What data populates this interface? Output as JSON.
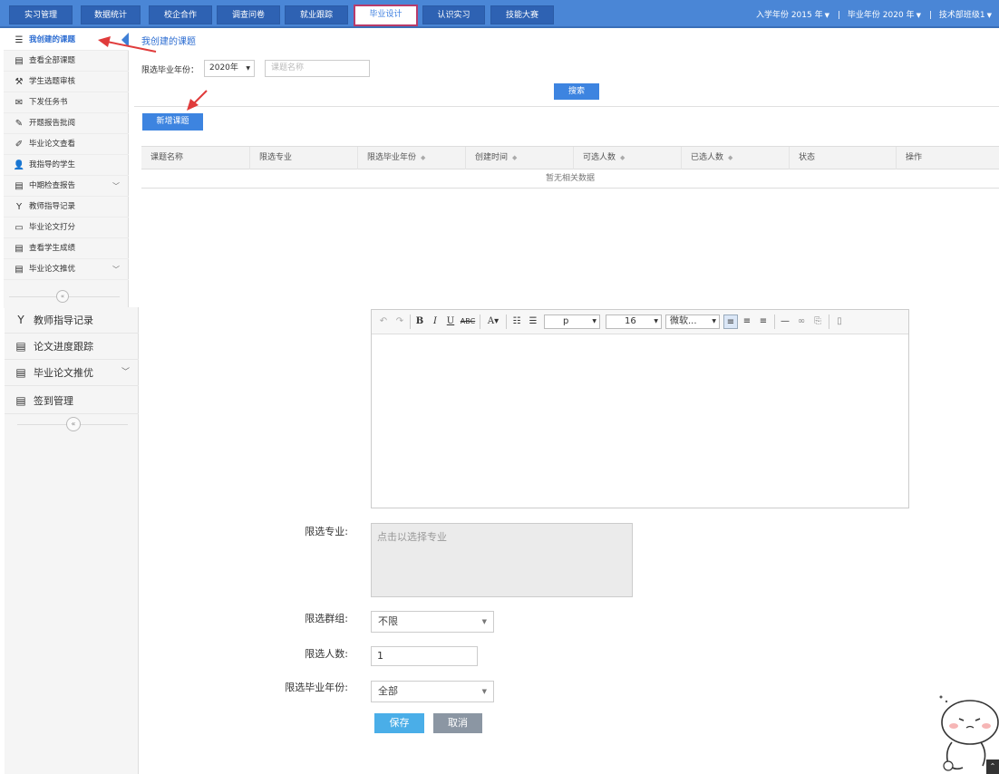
{
  "nav": {
    "tabs": [
      "实习管理",
      "数据统计",
      "校企合作",
      "调查问卷",
      "就业跟踪",
      "毕业设计",
      "认识实习",
      "技能大赛"
    ],
    "active_tab": "毕业设计",
    "enroll_label": "入学年份",
    "enroll_year": "2015 年",
    "grad_label": "毕业年份",
    "grad_year": "2020 年",
    "org": "技术部班级1"
  },
  "sidebar_top": {
    "items": [
      {
        "label": "我创建的课题",
        "icon": "list-icon"
      },
      {
        "label": "查看全部课题",
        "icon": "table-icon"
      },
      {
        "label": "学生选题审核",
        "icon": "gavel-icon"
      },
      {
        "label": "下发任务书",
        "icon": "envelope-icon"
      },
      {
        "label": "开题报告批阅",
        "icon": "pencil-icon"
      },
      {
        "label": "毕业论文查看",
        "icon": "edit-icon"
      },
      {
        "label": "我指导的学生",
        "icon": "user-icon"
      },
      {
        "label": "中期检查报告",
        "icon": "table-icon"
      },
      {
        "label": "教师指导记录",
        "icon": "cup-icon"
      },
      {
        "label": "毕业论文打分",
        "icon": "laptop-icon"
      },
      {
        "label": "查看学生成绩",
        "icon": "table-icon"
      },
      {
        "label": "毕业论文推优",
        "icon": "table-icon"
      }
    ]
  },
  "main": {
    "breadcrumb": "我创建的课题",
    "filter_label": "限选毕业年份：",
    "filter_year": "2020年",
    "search_placeholder": "课题名称",
    "search_button": "搜索",
    "new_button": "新增课题",
    "table": {
      "columns": [
        "课题名称",
        "限选专业",
        "限选毕业年份",
        "创建时间",
        "可选人数",
        "已选人数",
        "状态",
        "操作"
      ],
      "sortable": [
        false,
        false,
        true,
        true,
        true,
        true,
        false,
        false
      ],
      "empty_text": "暂无相关数据"
    }
  },
  "sidebar_bottom": {
    "items": [
      {
        "label": "教师指导记录",
        "icon": "cup-icon"
      },
      {
        "label": "论文进度跟踪",
        "icon": "table-icon"
      },
      {
        "label": "毕业论文推优",
        "icon": "table-icon"
      },
      {
        "label": "签到管理",
        "icon": "table-icon"
      }
    ]
  },
  "editor": {
    "paragraph": "p",
    "font_size": "16",
    "font_family": "微软..."
  },
  "form": {
    "major_label": "限选专业:",
    "major_placeholder": "点击以选择专业",
    "group_label": "限选群组:",
    "group_value": "不限",
    "count_label": "限选人数:",
    "count_value": "1",
    "year_label": "限选毕业年份:",
    "year_value": "全部",
    "save": "保存",
    "cancel": "取消"
  },
  "colors": {
    "primary": "#3d84e0",
    "nav": "#4a86d6",
    "arrow": "#e03b3b",
    "save": "#4aaee8",
    "cancel": "#8b96a3"
  }
}
